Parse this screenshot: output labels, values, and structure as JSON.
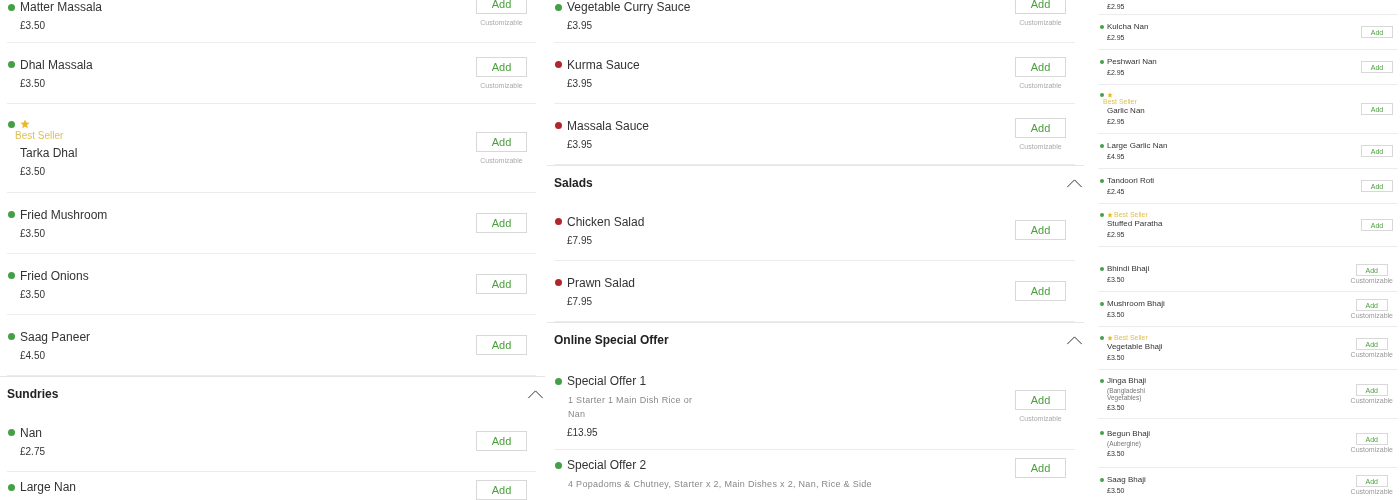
{
  "columns": [
    {
      "kind": "regular",
      "entries": [
        {
          "kind": "item",
          "color": "#43a047",
          "name": "Matter Massala",
          "price": "£3.50",
          "button": "Add",
          "note": "Customizable"
        },
        {
          "kind": "item",
          "color": "#43a047",
          "name": "Dhal Massala",
          "price": "£3.50",
          "button": "Add",
          "note": "Customizable"
        },
        {
          "kind": "item",
          "color": "#43a047",
          "badge": "Best Seller",
          "badge_inline": false,
          "name": "Tarka Dhal",
          "price": "£3.50",
          "button": "Add",
          "note": "Customizable"
        },
        {
          "kind": "item",
          "color": "#43a047",
          "name": "Fried Mushroom",
          "price": "£3.50",
          "button": "Add"
        },
        {
          "kind": "item",
          "color": "#43a047",
          "name": "Fried Onions",
          "price": "£3.50",
          "button": "Add"
        },
        {
          "kind": "item",
          "color": "#43a047",
          "name": "Saag Paneer",
          "price": "£4.50",
          "button": "Add"
        },
        {
          "kind": "section",
          "title": "Sundries",
          "expanded": true
        },
        {
          "kind": "item",
          "color": "#43a047",
          "name": "Nan",
          "price": "£2.75",
          "button": "Add"
        },
        {
          "kind": "item",
          "color": "#43a047",
          "name": "Large Nan",
          "button": "Add"
        }
      ]
    },
    {
      "kind": "regular",
      "entries": [
        {
          "kind": "item",
          "color": "#43a047",
          "name": "Vegetable Curry Sauce",
          "price": "£3.95",
          "button": "Add",
          "note": "Customizable"
        },
        {
          "kind": "item",
          "color": "#b0262a",
          "name": "Kurma Sauce",
          "price": "£3.95",
          "button": "Add",
          "note": "Customizable"
        },
        {
          "kind": "item",
          "color": "#b0262a",
          "name": "Massala Sauce",
          "price": "£3.95",
          "button": "Add",
          "note": "Customizable"
        },
        {
          "kind": "section",
          "title": "Salads",
          "expanded": true
        },
        {
          "kind": "item",
          "color": "#b0262a",
          "name": "Chicken Salad",
          "price": "£7.95",
          "button": "Add"
        },
        {
          "kind": "item",
          "color": "#b0262a",
          "name": "Prawn Salad",
          "price": "£7.95",
          "button": "Add"
        },
        {
          "kind": "section",
          "title": "Online Special Offer",
          "expanded": true
        },
        {
          "kind": "item",
          "color": "#43a047",
          "name": "Special Offer 1",
          "description": "1 Starter 1 Main Dish Rice or Nan",
          "price": "£13.95",
          "button": "Add",
          "note": "Customizable"
        },
        {
          "kind": "item",
          "color": "#43a047",
          "name": "Special Offer 2",
          "description": "4 Popadoms & Chutney, Starter x 2, Main Dishes x 2, Nan, Rice & Side",
          "button": "Add"
        }
      ]
    },
    {
      "kind": "compact",
      "entries": [
        {
          "kind": "item",
          "price": "£2.95"
        },
        {
          "kind": "item",
          "color": "#43a047",
          "name": "Kulcha Nan",
          "price": "£2.95",
          "button": "Add"
        },
        {
          "kind": "item",
          "color": "#43a047",
          "name": "Peshwari Nan",
          "price": "£2.95",
          "button": "Add"
        },
        {
          "kind": "item",
          "color": "#43a047",
          "badge": "Best Seller",
          "badge_inline": false,
          "name": "Garlic Nan",
          "price": "£2.95",
          "button": "Add"
        },
        {
          "kind": "item",
          "color": "#43a047",
          "name": "Large Garlic Nan",
          "price": "£4.95",
          "button": "Add"
        },
        {
          "kind": "item",
          "color": "#43a047",
          "name": "Tandoori Roti",
          "price": "£2.45",
          "button": "Add"
        },
        {
          "kind": "item",
          "color": "#43a047",
          "badge": "Best Seller",
          "badge_inline": true,
          "name": "Stuffed Paratha",
          "price": "£2.95",
          "button": "Add"
        },
        {
          "kind": "item",
          "color": "#43a047",
          "name": "Bhindi Bhaji",
          "price": "£3.50",
          "button": "Add",
          "note": "Customizable"
        },
        {
          "kind": "item",
          "color": "#43a047",
          "name": "Mushroom Bhaji",
          "price": "£3.50",
          "button": "Add",
          "note": "Customizable"
        },
        {
          "kind": "item",
          "color": "#43a047",
          "badge": "Best Seller",
          "badge_inline": true,
          "name": "Vegetable Bhaji",
          "price": "£3.50",
          "button": "Add",
          "note": "Customizable"
        },
        {
          "kind": "item",
          "color": "#43a047",
          "name": "Jinga Bhaji",
          "description": "(Bangladeshi Vegetables)",
          "price": "£3.50",
          "button": "Add",
          "note": "Customizable"
        },
        {
          "kind": "item",
          "color": "#43a047",
          "name": "Begun Bhaji",
          "description": "(Aubergine)",
          "price": "£3.50",
          "button": "Add",
          "note": "Customizable"
        },
        {
          "kind": "item",
          "color": "#43a047",
          "name": "Saag Bhaji",
          "price": "£3.50",
          "button": "Add",
          "note": "Customizable"
        }
      ]
    }
  ]
}
